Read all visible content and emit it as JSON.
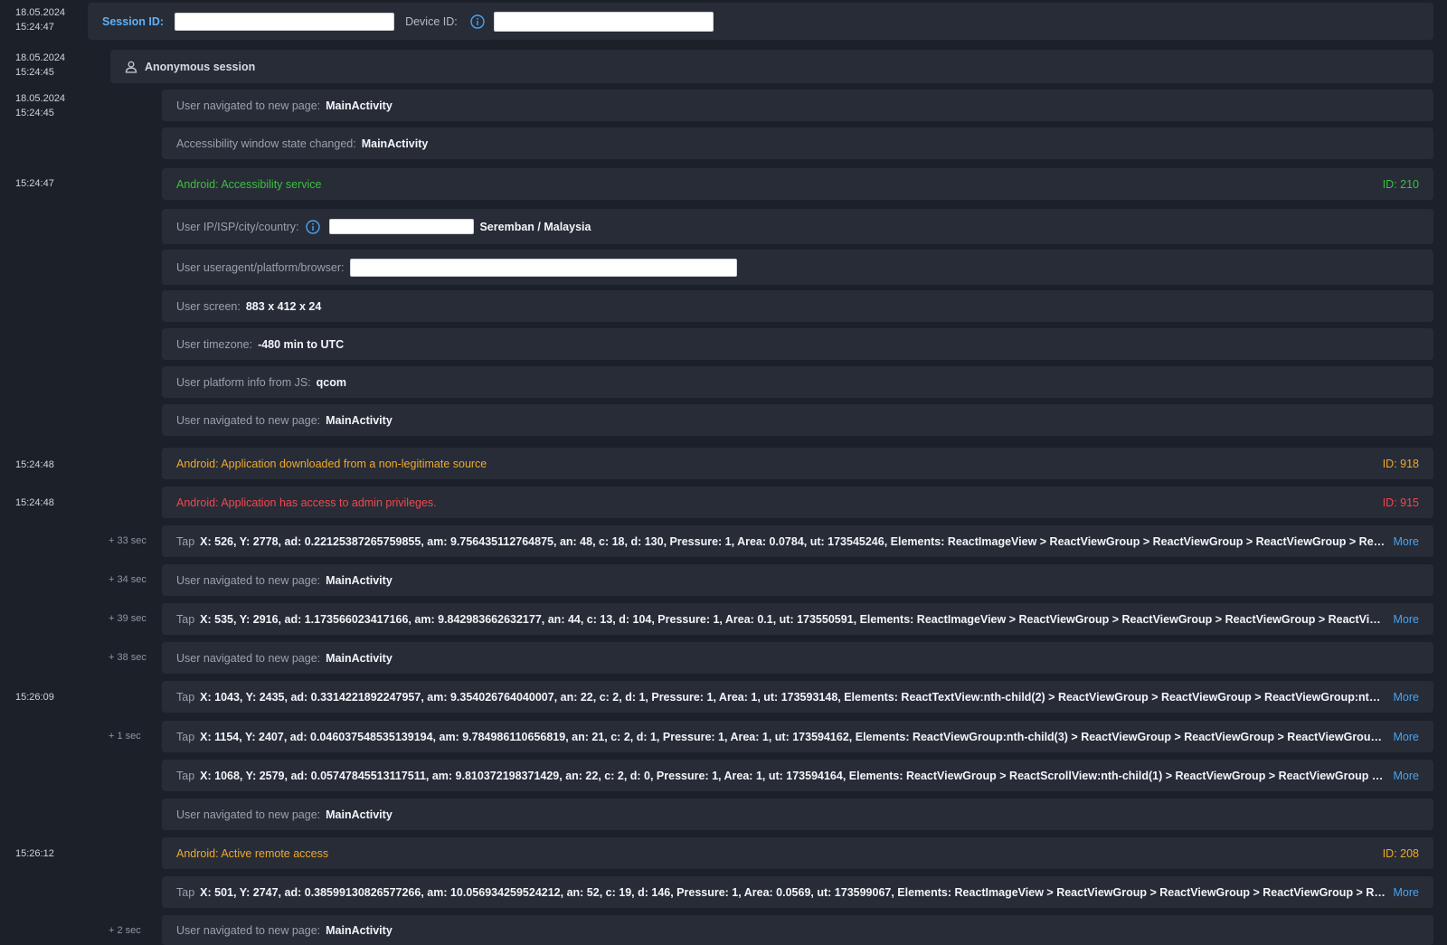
{
  "header": {
    "timestamp_date": "18.05.2024",
    "timestamp_time": "15:24:47",
    "session_label": "Session ID:",
    "device_label": "Device ID:"
  },
  "anon": {
    "timestamp_date": "18.05.2024",
    "timestamp_time": "15:24:45",
    "label": "Anonymous session"
  },
  "events": {
    "e1": {
      "date": "18.05.2024",
      "time": "15:24:45",
      "label": "User navigated to new page:",
      "value": "MainActivity"
    },
    "e2": {
      "label": "Accessibility window state changed:",
      "value": "MainActivity"
    },
    "e3": {
      "time": "15:24:47",
      "label": "Android: Accessibility service",
      "id": "ID: 210"
    },
    "e4": {
      "label": "User IP/ISP/city/country:",
      "value": "Seremban / Malaysia"
    },
    "e5": {
      "label": "User useragent/platform/browser:"
    },
    "e6": {
      "label": "User screen:",
      "value": "883 x 412 x 24"
    },
    "e7": {
      "label": "User timezone:",
      "value": "-480 min to UTC"
    },
    "e8": {
      "label": "User platform info from JS:",
      "value": "qcom"
    },
    "e9": {
      "label": "User navigated to new page:",
      "value": "MainActivity"
    },
    "e10": {
      "time": "15:24:48",
      "label": "Android: Application downloaded from a non-legitimate source",
      "id": "ID: 918"
    },
    "e11": {
      "time": "15:24:48",
      "label": "Android: Application has access to admin privileges.",
      "id": "ID: 915"
    },
    "e12": {
      "rel": "+ 33 sec",
      "label": "Tap",
      "value": "X: 526, Y: 2778, ad: 0.22125387265759855, am: 9.756435112764875, an: 48, c: 18, d: 130, Pressure: 1, Area: 0.0784, ut: 173545246, Elements: ReactImageView > ReactViewGroup > ReactViewGroup > ReactViewGroup > React...",
      "more": "More"
    },
    "e13": {
      "rel": "+ 34 sec",
      "label": "User navigated to new page:",
      "value": "MainActivity"
    },
    "e14": {
      "rel": "+ 39 sec",
      "label": "Tap",
      "value": "X: 535, Y: 2916, ad: 1.173566023417166, am: 9.842983662632177, an: 44, c: 13, d: 104, Pressure: 1, Area: 0.1, ut: 173550591, Elements: ReactImageView > ReactViewGroup > ReactViewGroup > ReactViewGroup > ReactViewG...",
      "more": "More"
    },
    "e15": {
      "rel": "+ 38 sec",
      "label": "User navigated to new page:",
      "value": "MainActivity"
    },
    "e16": {
      "time": "15:26:09",
      "label": "Tap",
      "value": "X: 1043, Y: 2435, ad: 0.3314221892247957, am: 9.354026764040007, an: 22, c: 2, d: 1, Pressure: 1, Area: 1, ut: 173593148, Elements: ReactTextView:nth-child(2) > ReactViewGroup > ReactViewGroup > ReactViewGroup:nth-chi...",
      "more": "More"
    },
    "e17": {
      "rel": "+ 1 sec",
      "label": "Tap",
      "value": "X: 1154, Y: 2407, ad: 0.046037548535139194, am: 9.784986110656819, an: 21, c: 2, d: 1, Pressure: 1, Area: 1, ut: 173594162, Elements: ReactViewGroup:nth-child(3) > ReactViewGroup > ReactViewGroup > ReactViewGroup:nt...",
      "more": "More"
    },
    "e18": {
      "label": "Tap",
      "value": "X: 1068, Y: 2579, ad: 0.05747845513117511, am: 9.810372198371429, an: 22, c: 2, d: 0, Pressure: 1, Area: 1, ut: 173594164, Elements: ReactViewGroup > ReactScrollView:nth-child(1) > ReactViewGroup > ReactViewGroup > Re...",
      "more": "More"
    },
    "e19": {
      "label": "User navigated to new page:",
      "value": "MainActivity"
    },
    "e20": {
      "time": "15:26:12",
      "label": "Android: Active remote access",
      "id": "ID: 208"
    },
    "e21": {
      "label": "Tap",
      "value": "X: 501, Y: 2747, ad: 0.38599130826577266, am: 10.056934259524212, an: 52, c: 19, d: 146, Pressure: 1, Area: 0.0569, ut: 173599067, Elements: ReactImageView > ReactViewGroup > ReactViewGroup > ReactViewGroup > Rea...",
      "more": "More"
    },
    "e22": {
      "rel": "+ 2 sec",
      "label": "User navigated to new page:",
      "value": "MainActivity"
    }
  },
  "colors": {
    "background": "#1c2029",
    "row": "#272c37",
    "green": "#3fbf3f",
    "orange": "#f0a92a",
    "red": "#f0484e",
    "link": "#4aa3f0"
  },
  "icons": {
    "info": "info-circle-icon",
    "user": "user-icon"
  }
}
